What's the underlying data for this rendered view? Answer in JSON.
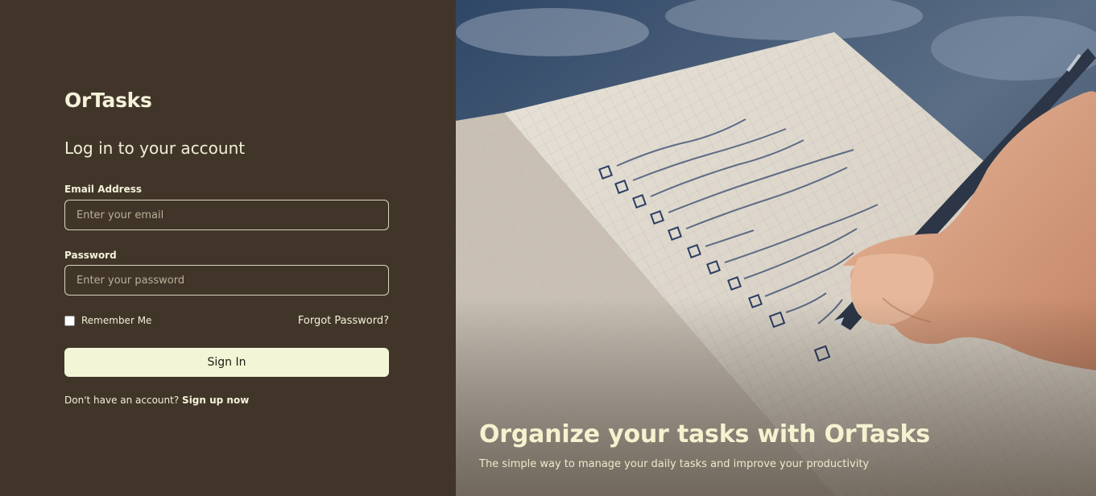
{
  "brand": "OrTasks",
  "login": {
    "heading": "Log in to your account",
    "email_label": "Email Address",
    "email_placeholder": "Enter your email",
    "password_label": "Password",
    "password_placeholder": "Enter your password",
    "remember_label": "Remember Me",
    "forgot_label": "Forgot Password?",
    "signin_label": "Sign In",
    "signup_prompt": "Don't have an account?",
    "signup_link": "Sign up now"
  },
  "hero": {
    "title": "Organize your tasks with OrTasks",
    "subtitle": "The simple way to manage your daily tasks and improve your productivity"
  },
  "colors": {
    "panel_bg": "#41352a",
    "accent": "#f3f6d6",
    "text": "#f4f2d8"
  }
}
